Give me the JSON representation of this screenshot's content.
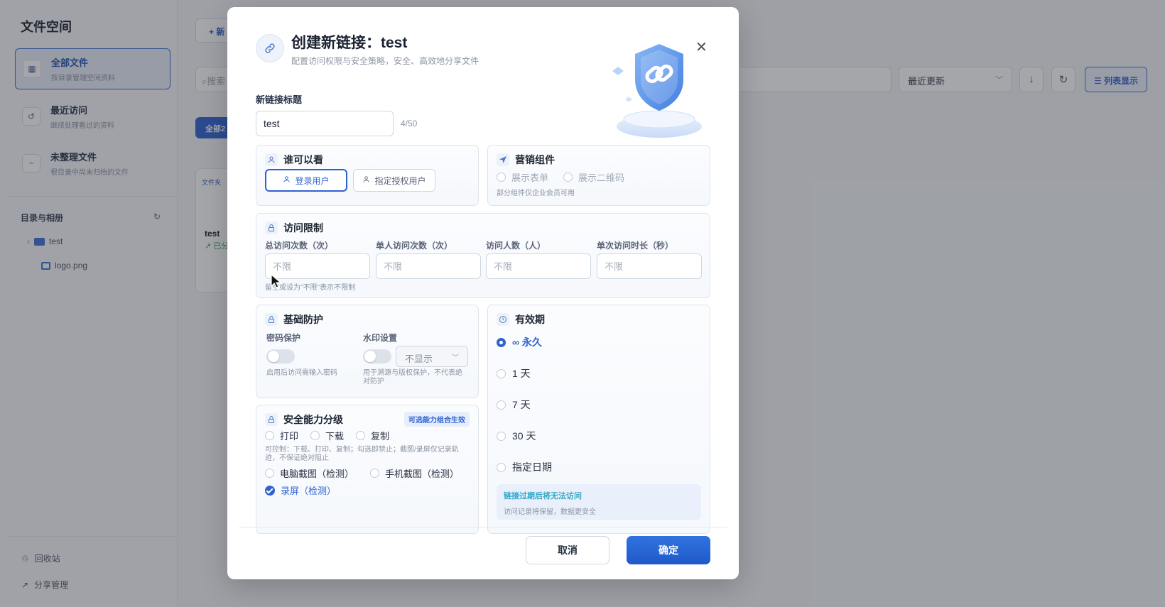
{
  "app": {
    "title": "文件空间",
    "nav": [
      {
        "title": "全部文件",
        "desc": "按目录管理空间资料"
      },
      {
        "title": "最近访问",
        "desc": "继续处理看过的资料"
      },
      {
        "title": "未整理文件",
        "desc": "根目录中尚未归档的文件"
      }
    ],
    "dir_title": "目录与相册",
    "tree": [
      {
        "name": "test"
      },
      {
        "name": "logo.png"
      }
    ],
    "footer": [
      {
        "label": "回收站"
      },
      {
        "label": "分享管理"
      }
    ],
    "toolbar": {
      "new_label": "+ 新",
      "search_placeholder": "搜索",
      "sort_value": "最近更新",
      "list_view_label": "☰ 列表显示"
    },
    "chip_label": "全部2",
    "card": {
      "tag": "文件夹",
      "name": "test",
      "status": "↗ 已分"
    }
  },
  "modal": {
    "title": "创建新链接：test",
    "subtitle": "配置访问权限与安全策略，安全、高效地分享文件",
    "title_label": "新链接标题",
    "title_value": "test",
    "counter": "4/50",
    "audience": {
      "heading": "谁可以看",
      "options": [
        "登录用户",
        "指定授权用户"
      ]
    },
    "marketing": {
      "heading": "营销组件",
      "options": [
        "展示表单",
        "展示二维码"
      ],
      "note": "部分组件仅企业会员可用"
    },
    "limits": {
      "heading": "访问限制",
      "fields": [
        {
          "label": "总访问次数（次）",
          "placeholder": "不限"
        },
        {
          "label": "单人访问次数（次）",
          "placeholder": "不限"
        },
        {
          "label": "访问人数（人）",
          "placeholder": "不限"
        },
        {
          "label": "单次访问时长（秒）",
          "placeholder": "不限"
        }
      ],
      "note": "留空或设为\"不限\"表示不限制"
    },
    "protection": {
      "heading": "基础防护",
      "password_label": "密码保护",
      "password_note": "启用后访问需输入密码",
      "watermark_label": "水印设置",
      "watermark_value": "不显示",
      "watermark_note": "用于溯源与版权保护，不代表绝对防护"
    },
    "security": {
      "heading": "安全能力分级",
      "badge": "可选能力组合生效",
      "row1": [
        "打印",
        "下载",
        "复制"
      ],
      "note": "可控制：下载、打印、复制；勾选即禁止；截图/录屏仅记录轨迹，不保证绝对阻止",
      "row2": [
        "电脑截图（检测）",
        "手机截图（检测）"
      ],
      "row3": "录屏（检测）"
    },
    "expiry": {
      "heading": "有效期",
      "options": [
        "∞ 永久",
        "1 天",
        "7 天",
        "30 天",
        "指定日期"
      ],
      "info_title": "链接过期后将无法访问",
      "info_desc": "访问记录将保留，数据更安全"
    },
    "cancel_label": "取消",
    "ok_label": "确定"
  },
  "colors": {
    "accent": "#2f62d0",
    "info": "#33a6c7"
  }
}
